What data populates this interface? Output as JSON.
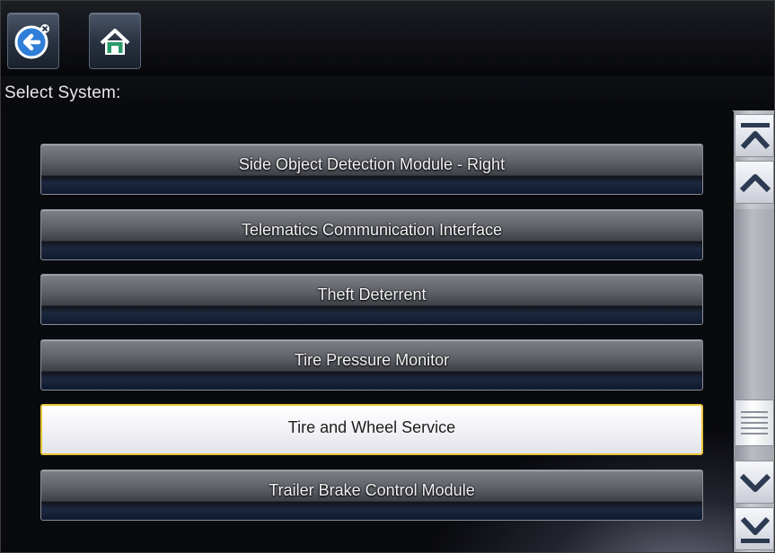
{
  "header": {
    "title": "Select System:"
  },
  "toolbar": {
    "buttons": [
      {
        "name": "back",
        "icon": "back-arrow-icon"
      },
      {
        "name": "home",
        "icon": "home-icon"
      }
    ]
  },
  "systems": {
    "items": [
      {
        "label": "Side Object Detection Module - Right",
        "selected": false
      },
      {
        "label": "Telematics Communication Interface",
        "selected": false
      },
      {
        "label": "Theft Deterrent",
        "selected": false
      },
      {
        "label": "Tire Pressure Monitor",
        "selected": false
      },
      {
        "label": "Tire and Wheel Service",
        "selected": true
      },
      {
        "label": "Trailer Brake Control Module",
        "selected": false
      }
    ]
  },
  "scrollbar": {
    "icons": [
      "scroll-top-icon",
      "scroll-up-icon",
      "scroll-thumb-grip-icon",
      "scroll-down-icon",
      "scroll-bottom-icon"
    ]
  },
  "colors": {
    "selection_border": "#e9c53a",
    "button_text": "#f2f2f4",
    "background": "#090a0e"
  }
}
